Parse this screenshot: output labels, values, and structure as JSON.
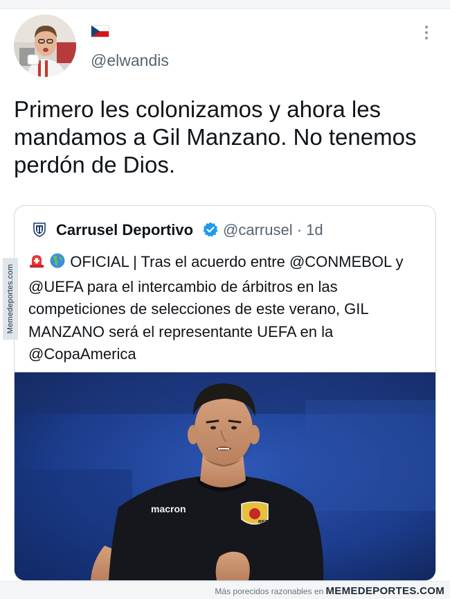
{
  "tweet": {
    "handle": "@elwandis",
    "flag_icon": "czech-flag-icon",
    "text": "Primero les colonizamos y ahora les mandamos a Gil Manzano. No tenemos perdón de Dios."
  },
  "quoted_tweet": {
    "account_name": "Carrusel Deportivo",
    "meta": "@carrusel · 1d",
    "text": "OFICIAL | Tras el acuerdo entre @CONMEBOL y @UEFA para el intercambio de árbitros en las competiciones de selecciones de este verano, GIL MANZANO será el representante UEFA en la @CopaAmerica",
    "emoji_icons": [
      "siren-icon",
      "globe-americas-icon"
    ],
    "photo": {
      "shirt_brand": "macron",
      "crest_label": "RFEF"
    }
  },
  "watermark": {
    "side_text": "Memedeportes.com",
    "footer_text": "Más porecidos razonables en ",
    "footer_brand": "MEMEDEPORTES.COM"
  },
  "colors": {
    "verified_blue": "#1d9bf0",
    "secondary_text": "#536471",
    "border": "#cfd9de"
  }
}
